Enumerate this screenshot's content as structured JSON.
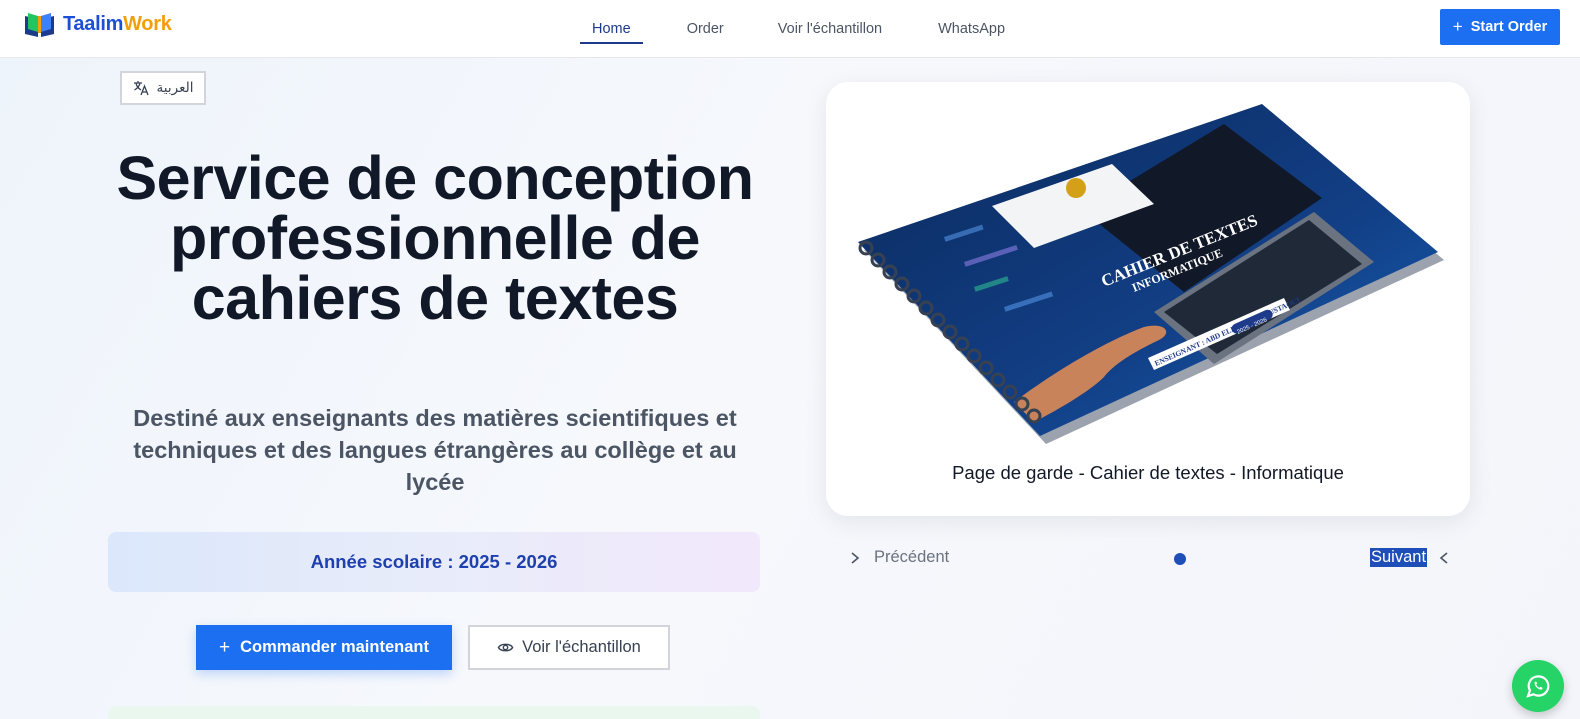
{
  "brand": {
    "part1": "Taalim",
    "part2": "Work"
  },
  "nav": {
    "items": [
      {
        "label": "Home"
      },
      {
        "label": "Order"
      },
      {
        "label": "Voir l'échantillon"
      },
      {
        "label": "WhatsApp"
      }
    ],
    "active": "Home",
    "cta_label": "Start Order"
  },
  "language_toggle": {
    "label": "العربية",
    "icon": "translate-icon"
  },
  "hero": {
    "title": "Service de conception professionnelle de cahiers de textes",
    "subtitle": "Destiné aux enseignants des matières scientifiques et techniques et des langues étrangères au collège et au lycée",
    "school_year": "Année scolaire : 2025 - 2026",
    "primary_cta": "Commander maintenant",
    "secondary_cta": "Voir l'échantillon"
  },
  "carousel": {
    "caption": "Page de garde - Cahier de textes - Informatique",
    "prev_label": "Précédent",
    "next_label": "Suivant",
    "slide_count": 1,
    "image_text": {
      "title": "CAHIER DE TEXTES",
      "subject": "INFORMATIQUE",
      "teacher": "ENSEIGNANT : ABD ELKARIM MOUSTAOUI",
      "year": "2025 - 2026"
    }
  },
  "colors": {
    "primary": "#1d6ff2",
    "brand_blue": "#1d4ed8",
    "brand_orange": "#f59e0b",
    "whatsapp": "#25d366"
  }
}
